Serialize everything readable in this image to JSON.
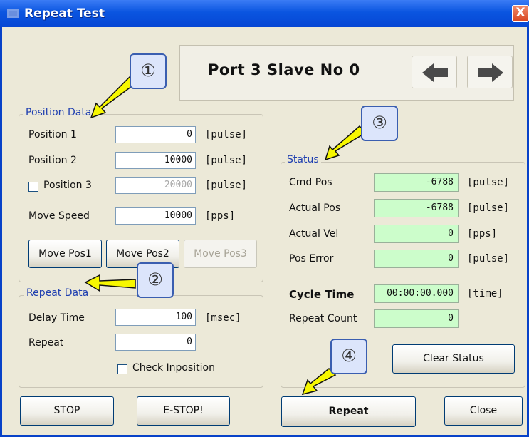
{
  "window": {
    "title": "Repeat Test",
    "close_label": "X"
  },
  "header": {
    "title": "Port 3 Slave No 0",
    "prev_icon": "arrow-left-icon",
    "next_icon": "arrow-right-icon"
  },
  "position_data": {
    "legend": "Position Data",
    "rows": [
      {
        "label": "Position 1",
        "value": "0",
        "unit": "[pulse]"
      },
      {
        "label": "Position 2",
        "value": "10000",
        "unit": "[pulse]"
      },
      {
        "label": "Position 3",
        "value": "20000",
        "unit": "[pulse]",
        "checkbox": true,
        "checked": false,
        "disabled": true
      },
      {
        "label": "Move Speed",
        "value": "10000",
        "unit": "[pps]"
      }
    ],
    "buttons": [
      "Move Pos1",
      "Move Pos2",
      "Move Pos3"
    ]
  },
  "repeat_data": {
    "legend": "Repeat Data",
    "rows": [
      {
        "label": "Delay Time",
        "value": "100",
        "unit": "[msec]"
      },
      {
        "label": "Repeat",
        "value": "0",
        "unit": ""
      }
    ],
    "check_inposition": {
      "label": "Check Inposition",
      "checked": false
    }
  },
  "status": {
    "legend": "Status",
    "rows": [
      {
        "label": "Cmd Pos",
        "value": "-6788",
        "unit": "[pulse]"
      },
      {
        "label": "Actual Pos",
        "value": "-6788",
        "unit": "[pulse]"
      },
      {
        "label": "Actual Vel",
        "value": "0",
        "unit": "[pps]"
      },
      {
        "label": "Pos Error",
        "value": "0",
        "unit": "[pulse]"
      },
      {
        "label": "Cycle Time",
        "value": "00:00:00.000",
        "unit": "[time]",
        "bold": true
      },
      {
        "label": "Repeat Count",
        "value": "0",
        "unit": ""
      }
    ],
    "clear_button": "Clear Status"
  },
  "footer": {
    "stop": "STOP",
    "estop": "E-STOP!",
    "repeat": "Repeat",
    "close": "Close"
  },
  "callouts": [
    "①",
    "②",
    "③",
    "④"
  ],
  "colors": {
    "titlebar": "#0a55e0",
    "readonly_bg": "#ccfdcb",
    "legend_text": "#1f3fb0",
    "callout_bg": "#dce5fb",
    "arrow_yellow": "#f7f700"
  }
}
